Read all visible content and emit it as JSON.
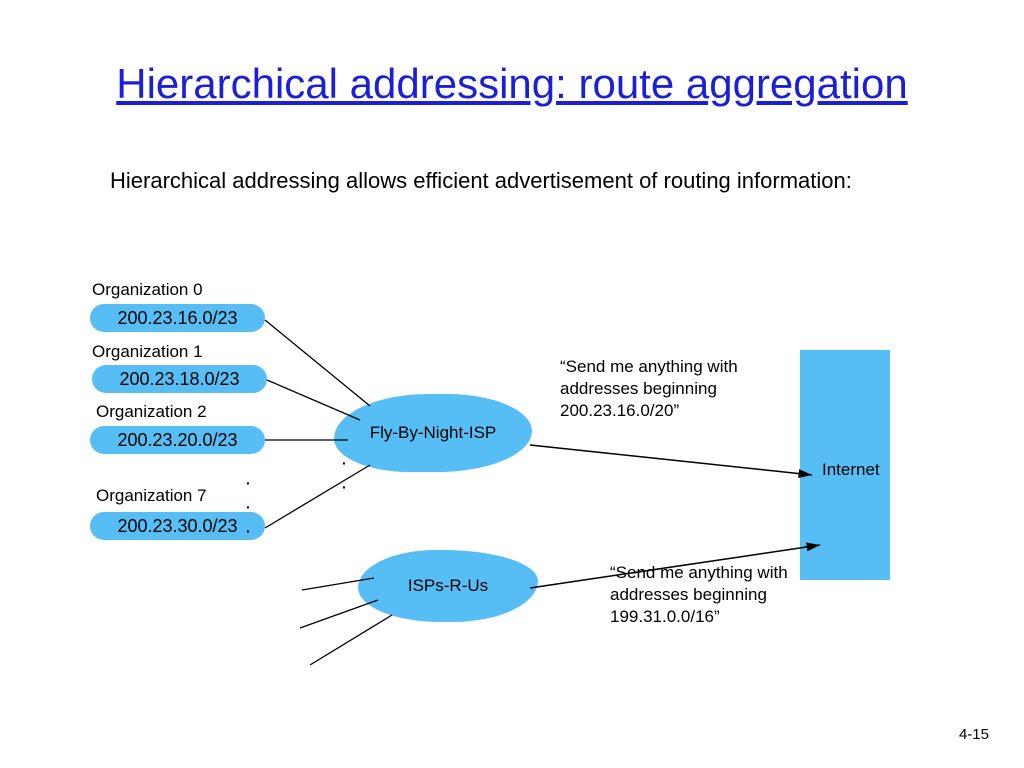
{
  "title": "Hierarchical addressing: route aggregation",
  "subtitle": "Hierarchical addressing allows efficient advertisement of routing information:",
  "orgs": [
    {
      "label": "Organization 0",
      "cidr": "200.23.16.0/23"
    },
    {
      "label": "Organization 1",
      "cidr": "200.23.18.0/23"
    },
    {
      "label": "Organization 2",
      "cidr": "200.23.20.0/23"
    },
    {
      "label": "Organization 7",
      "cidr": "200.23.30.0/23"
    }
  ],
  "isp1": "Fly-By-Night-ISP",
  "isp2": "ISPs-R-Us",
  "internet": "Internet",
  "ann1": "“Send me anything with addresses beginning 200.23.16.0/20”",
  "ann2": "“Send me anything with addresses beginning 199.31.0.0/16”",
  "pagenum": "4-15",
  "colors": {
    "accent": "#57bef5",
    "title": "#1b1fd8"
  }
}
